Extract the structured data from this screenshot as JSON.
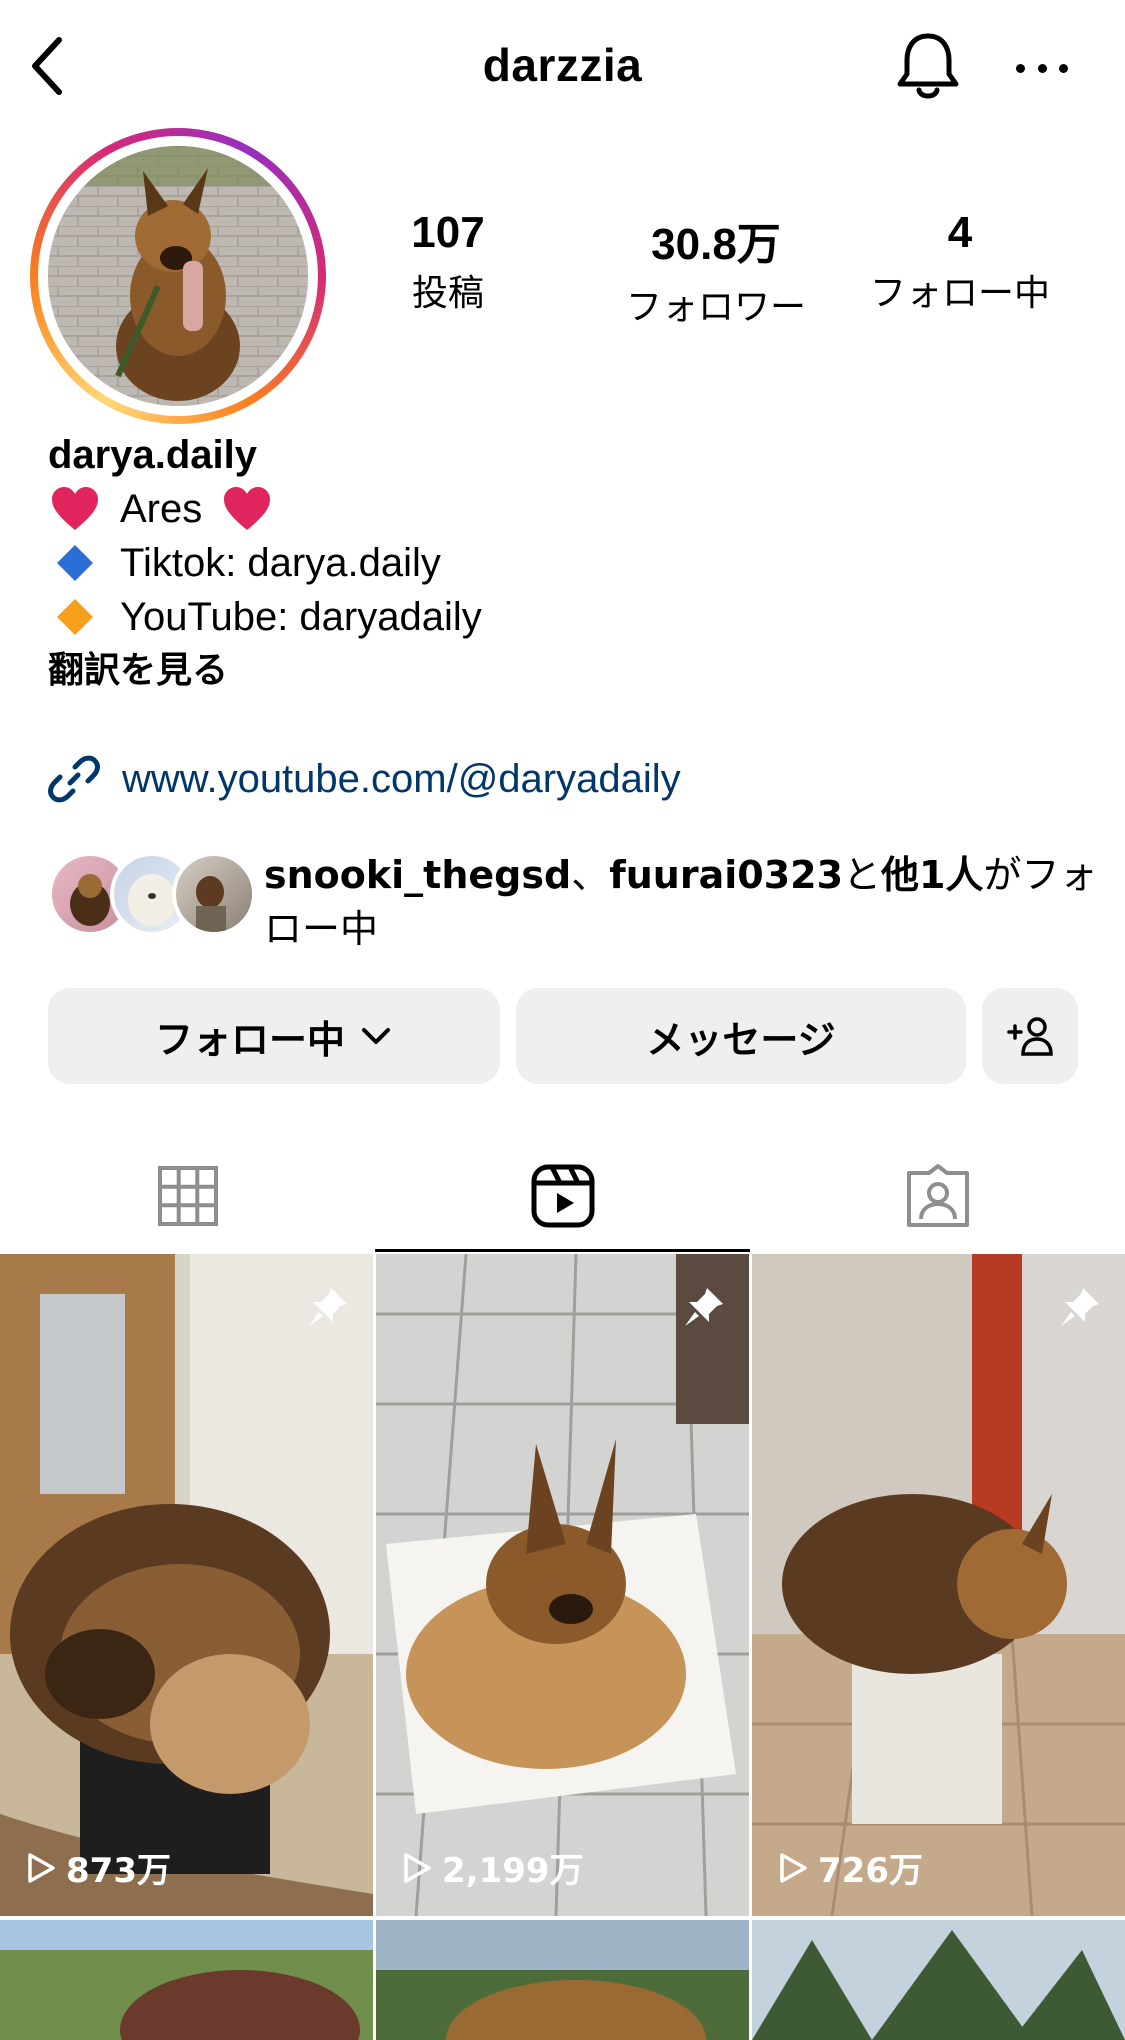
{
  "header": {
    "username": "darzzia",
    "back_icon": "chevron-left-icon",
    "bell_icon": "bell-icon",
    "more_icon": "more-horizontal-icon"
  },
  "profile": {
    "stats": [
      {
        "value": "107",
        "label": "投稿"
      },
      {
        "value": "30.8万",
        "label": "フォロワー"
      },
      {
        "value": "4",
        "label": "フォロー中"
      }
    ]
  },
  "bio": {
    "name": "darya.daily",
    "lines": [
      {
        "emoji": "red-heart",
        "text": "Ares"
      },
      {
        "emoji": "blue-diamond",
        "text": "Tiktok: darya.daily"
      },
      {
        "emoji": "orange-diamond",
        "text": "YouTube: daryadaily"
      }
    ],
    "translate_label": "翻訳を見る",
    "link": "www.youtube.com/@daryadaily"
  },
  "followed_by": {
    "user1": "snooki_thegsd",
    "sep": "、",
    "user2": "fuurai0323",
    "mid": "と",
    "others": "他1人",
    "tail": "がフォロー中"
  },
  "actions": {
    "follow_label": "フォロー中",
    "message_label": "メッセージ"
  },
  "tabs": [
    {
      "name": "posts",
      "icon": "grid-icon",
      "active": false
    },
    {
      "name": "reels",
      "icon": "reels-icon",
      "active": true
    },
    {
      "name": "tagged",
      "icon": "tagged-person-icon",
      "active": false
    }
  ],
  "grid": {
    "items": [
      {
        "views": "873万",
        "pinned": true
      },
      {
        "views": "2,199万",
        "pinned": true
      },
      {
        "views": "726万",
        "pinned": true
      }
    ]
  },
  "colors": {
    "link": "#00376b",
    "button_bg": "#efefef",
    "heart": "#e0245e",
    "blue_diamond": "#2b6fd6",
    "orange_diamond": "#f59f1b"
  }
}
